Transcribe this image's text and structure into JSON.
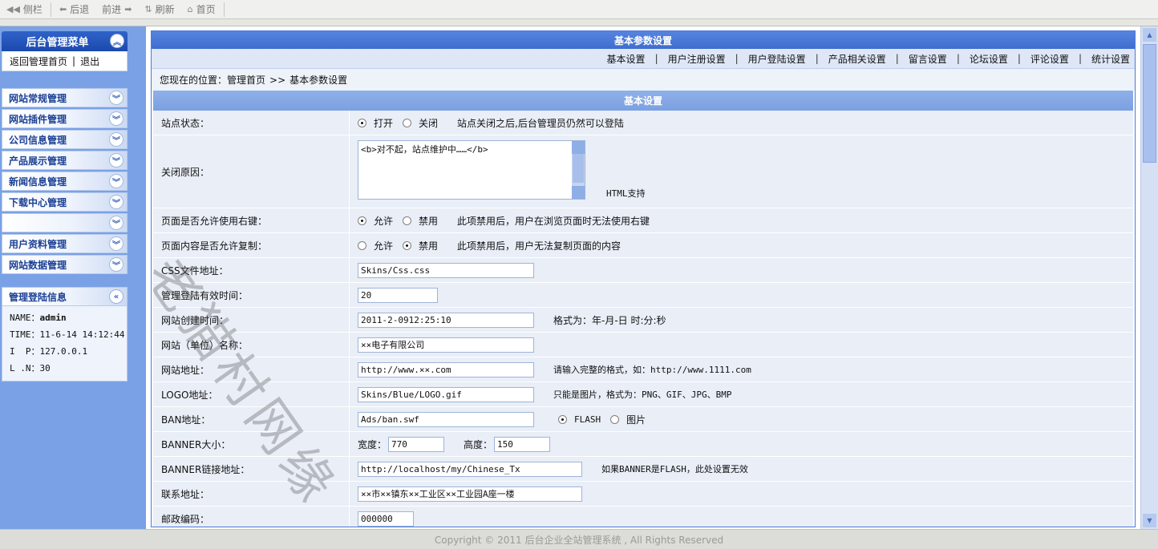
{
  "toolbar": {
    "items": [
      {
        "icon": "sidebar-toggle-icon",
        "glyph": "◀◀",
        "label": "侧栏"
      },
      {
        "icon": "back-arrow-icon",
        "glyph": "⬅",
        "label": "后退"
      },
      {
        "icon": "forward-arrow-icon",
        "glyph": "➡",
        "label": "前进"
      },
      {
        "icon": "refresh-icon",
        "glyph": "⇅",
        "label": "刷新"
      },
      {
        "icon": "home-icon",
        "glyph": "⌂",
        "label": "首页"
      }
    ]
  },
  "sidebar": {
    "menu_title": "后台管理菜单",
    "collapse_glyph": "︽",
    "expand_glyph": "︾",
    "link_home": "返回管理首页",
    "link_sep": "|",
    "link_logout": "退出",
    "categories": [
      {
        "label": "网站常规管理"
      },
      {
        "label": "网站插件管理"
      },
      {
        "label": "公司信息管理"
      },
      {
        "label": "产品展示管理"
      },
      {
        "label": "新闻信息管理"
      },
      {
        "label": "下载中心管理"
      },
      {
        "label": ""
      },
      {
        "label": "用户资料管理"
      },
      {
        "label": "网站数据管理"
      }
    ],
    "login_title": "管理登陆信息",
    "login_glyph": "«",
    "login": {
      "name_label": "NAME：",
      "name": "admin",
      "time": "TIME：11-6-14 14:12:44",
      "ip": "I  P：127.0.0.1",
      "ln": "L .N：30"
    }
  },
  "main": {
    "title": "基本参数设置",
    "tabs": [
      "基本设置",
      "用户注册设置",
      "用户登陆设置",
      "产品相关设置",
      "留言设置",
      "论坛设置",
      "评论设置",
      "统计设置"
    ],
    "tab_sep": "|",
    "crumb_prefix": "您现在的位置：",
    "crumb_home": "管理首页",
    "crumb_sep": ">>",
    "crumb_current": "基本参数设置",
    "section_title": "基本设置",
    "rows": {
      "site_status": {
        "label": "站点状态：",
        "opt1": "打开",
        "opt2": "关闭",
        "note": "站点关闭之后,后台管理员仍然可以登陆"
      },
      "close_reason": {
        "label": "关闭原因：",
        "value": "<b>对不起，站点维护中……</b>",
        "note": "HTML支持"
      },
      "right_click": {
        "label": "页面是否允许使用右键：",
        "opt1": "允许",
        "opt2": "禁用",
        "note": "此项禁用后，用户在浏览页面时无法使用右键"
      },
      "copy": {
        "label": "页面内容是否允许复制：",
        "opt1": "允许",
        "opt2": "禁用",
        "note": "此项禁用后，用户无法复制页面的内容"
      },
      "css": {
        "label": "CSS文件地址：",
        "value": "Skins/Css.css"
      },
      "login_time": {
        "label": "管理登陆有效时间：",
        "value": "20"
      },
      "create_time": {
        "label": "网站创建时间：",
        "value": "2011-2-0912:25:10",
        "note": "格式为：年-月-日 时:分:秒"
      },
      "site_name": {
        "label": "网站（单位）名称：",
        "value": "××电子有限公司"
      },
      "site_url": {
        "label": "网站地址：",
        "value": "http://www.××.com",
        "note": "请输入完整的格式，如：http://www.1111.com"
      },
      "logo": {
        "label": "LOGO地址：",
        "value": "Skins/Blue/LOGO.gif",
        "note": "只能是图片，格式为：PNG、GIF、JPG、BMP"
      },
      "ban": {
        "label": "BAN地址：",
        "value": "Ads/ban.swf",
        "opt1": "FLASH",
        "opt2": "图片"
      },
      "banner_size": {
        "label": "BANNER大小：",
        "width_label": "宽度：",
        "width": "770",
        "height_label": "高度：",
        "height": "150"
      },
      "banner_link": {
        "label": "BANNER链接地址：",
        "value": "http://localhost/my/Chinese_Tx",
        "note": "如果BANNER是FLASH，此处设置无效"
      },
      "address": {
        "label": "联系地址：",
        "value": "××市××镇东××工业区××工业园A座一楼"
      },
      "postcode": {
        "label": "邮政编码：",
        "value": "000000"
      }
    }
  },
  "footer": {
    "text": "Copyright © 2011 后台企业全站管理系统 , All Rights Reserved"
  },
  "watermark": {
    "text": "老猫村网缘"
  },
  "colors": {
    "accent": "#3e6dcf",
    "sidebar_bg": "#7aa1e6",
    "form_bg": "#e9eef7"
  }
}
